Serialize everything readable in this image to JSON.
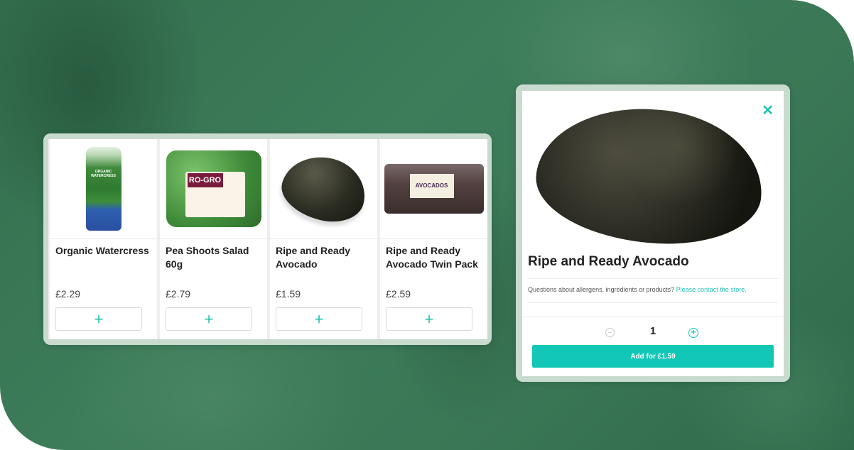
{
  "products": [
    {
      "name": "Organic Watercress",
      "price": "£2.29",
      "add_label": "+",
      "image_alt": "watercress-pack-icon",
      "pack_text": "ORGANIC WATERCRESS"
    },
    {
      "name": "Pea Shoots Salad 60g",
      "price": "£2.79",
      "add_label": "+",
      "image_alt": "pea-shoots-pack-icon",
      "brand_text": "RO-GRO"
    },
    {
      "name": "Ripe and Ready Avocado",
      "price": "£1.59",
      "add_label": "+",
      "image_alt": "avocado-icon"
    },
    {
      "name": "Ripe and Ready Avocado Twin Pack",
      "price": "£2.59",
      "add_label": "+",
      "image_alt": "avocado-twin-pack-icon",
      "pack_text": "AVOCADOS"
    }
  ],
  "modal": {
    "close_label": "✕",
    "title": "Ripe and Ready Avocado",
    "allergen_text": "Questions about allergens, ingredients or products?",
    "contact_link": "Please contact the store.",
    "qty_minus": "−",
    "quantity": "1",
    "qty_plus": "+",
    "add_button": "Add for £1.59"
  },
  "colors": {
    "accent": "#13c7b6",
    "background": "#3a7756",
    "panel": "#c9dacf"
  }
}
